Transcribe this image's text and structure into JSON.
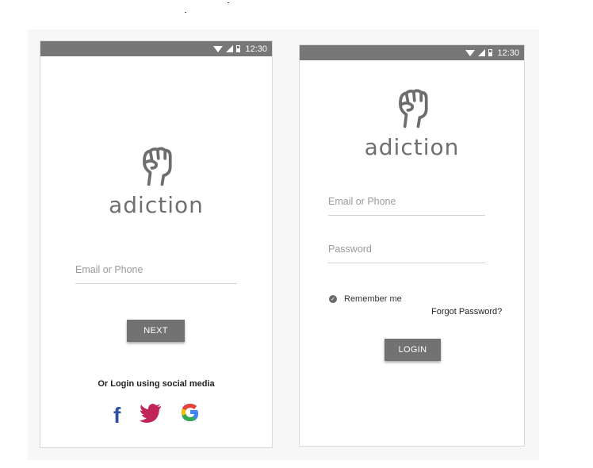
{
  "status_bar": {
    "time": "12:30"
  },
  "brand": {
    "name": "adiction",
    "logo_icon": "fist-icon"
  },
  "screen1": {
    "email_placeholder": "Email or Phone",
    "next_label": "NEXT",
    "social_title": "Or Login using social media",
    "social_icons": {
      "facebook": {
        "glyph": "f",
        "color": "#2f4fa0"
      },
      "twitter": {
        "icon": "twitter-bird-icon",
        "color": "#c0245a"
      },
      "google": {
        "glyph": "G"
      }
    }
  },
  "screen2": {
    "email_placeholder": "Email or Phone",
    "password_placeholder": "Password",
    "remember_label": "Remember me",
    "forgot_label": "Forgot Password?",
    "login_label": "LOGIN"
  },
  "colors": {
    "status_bar": "#777777",
    "button": "#727272",
    "brand_gray": "#6f6f6f"
  }
}
